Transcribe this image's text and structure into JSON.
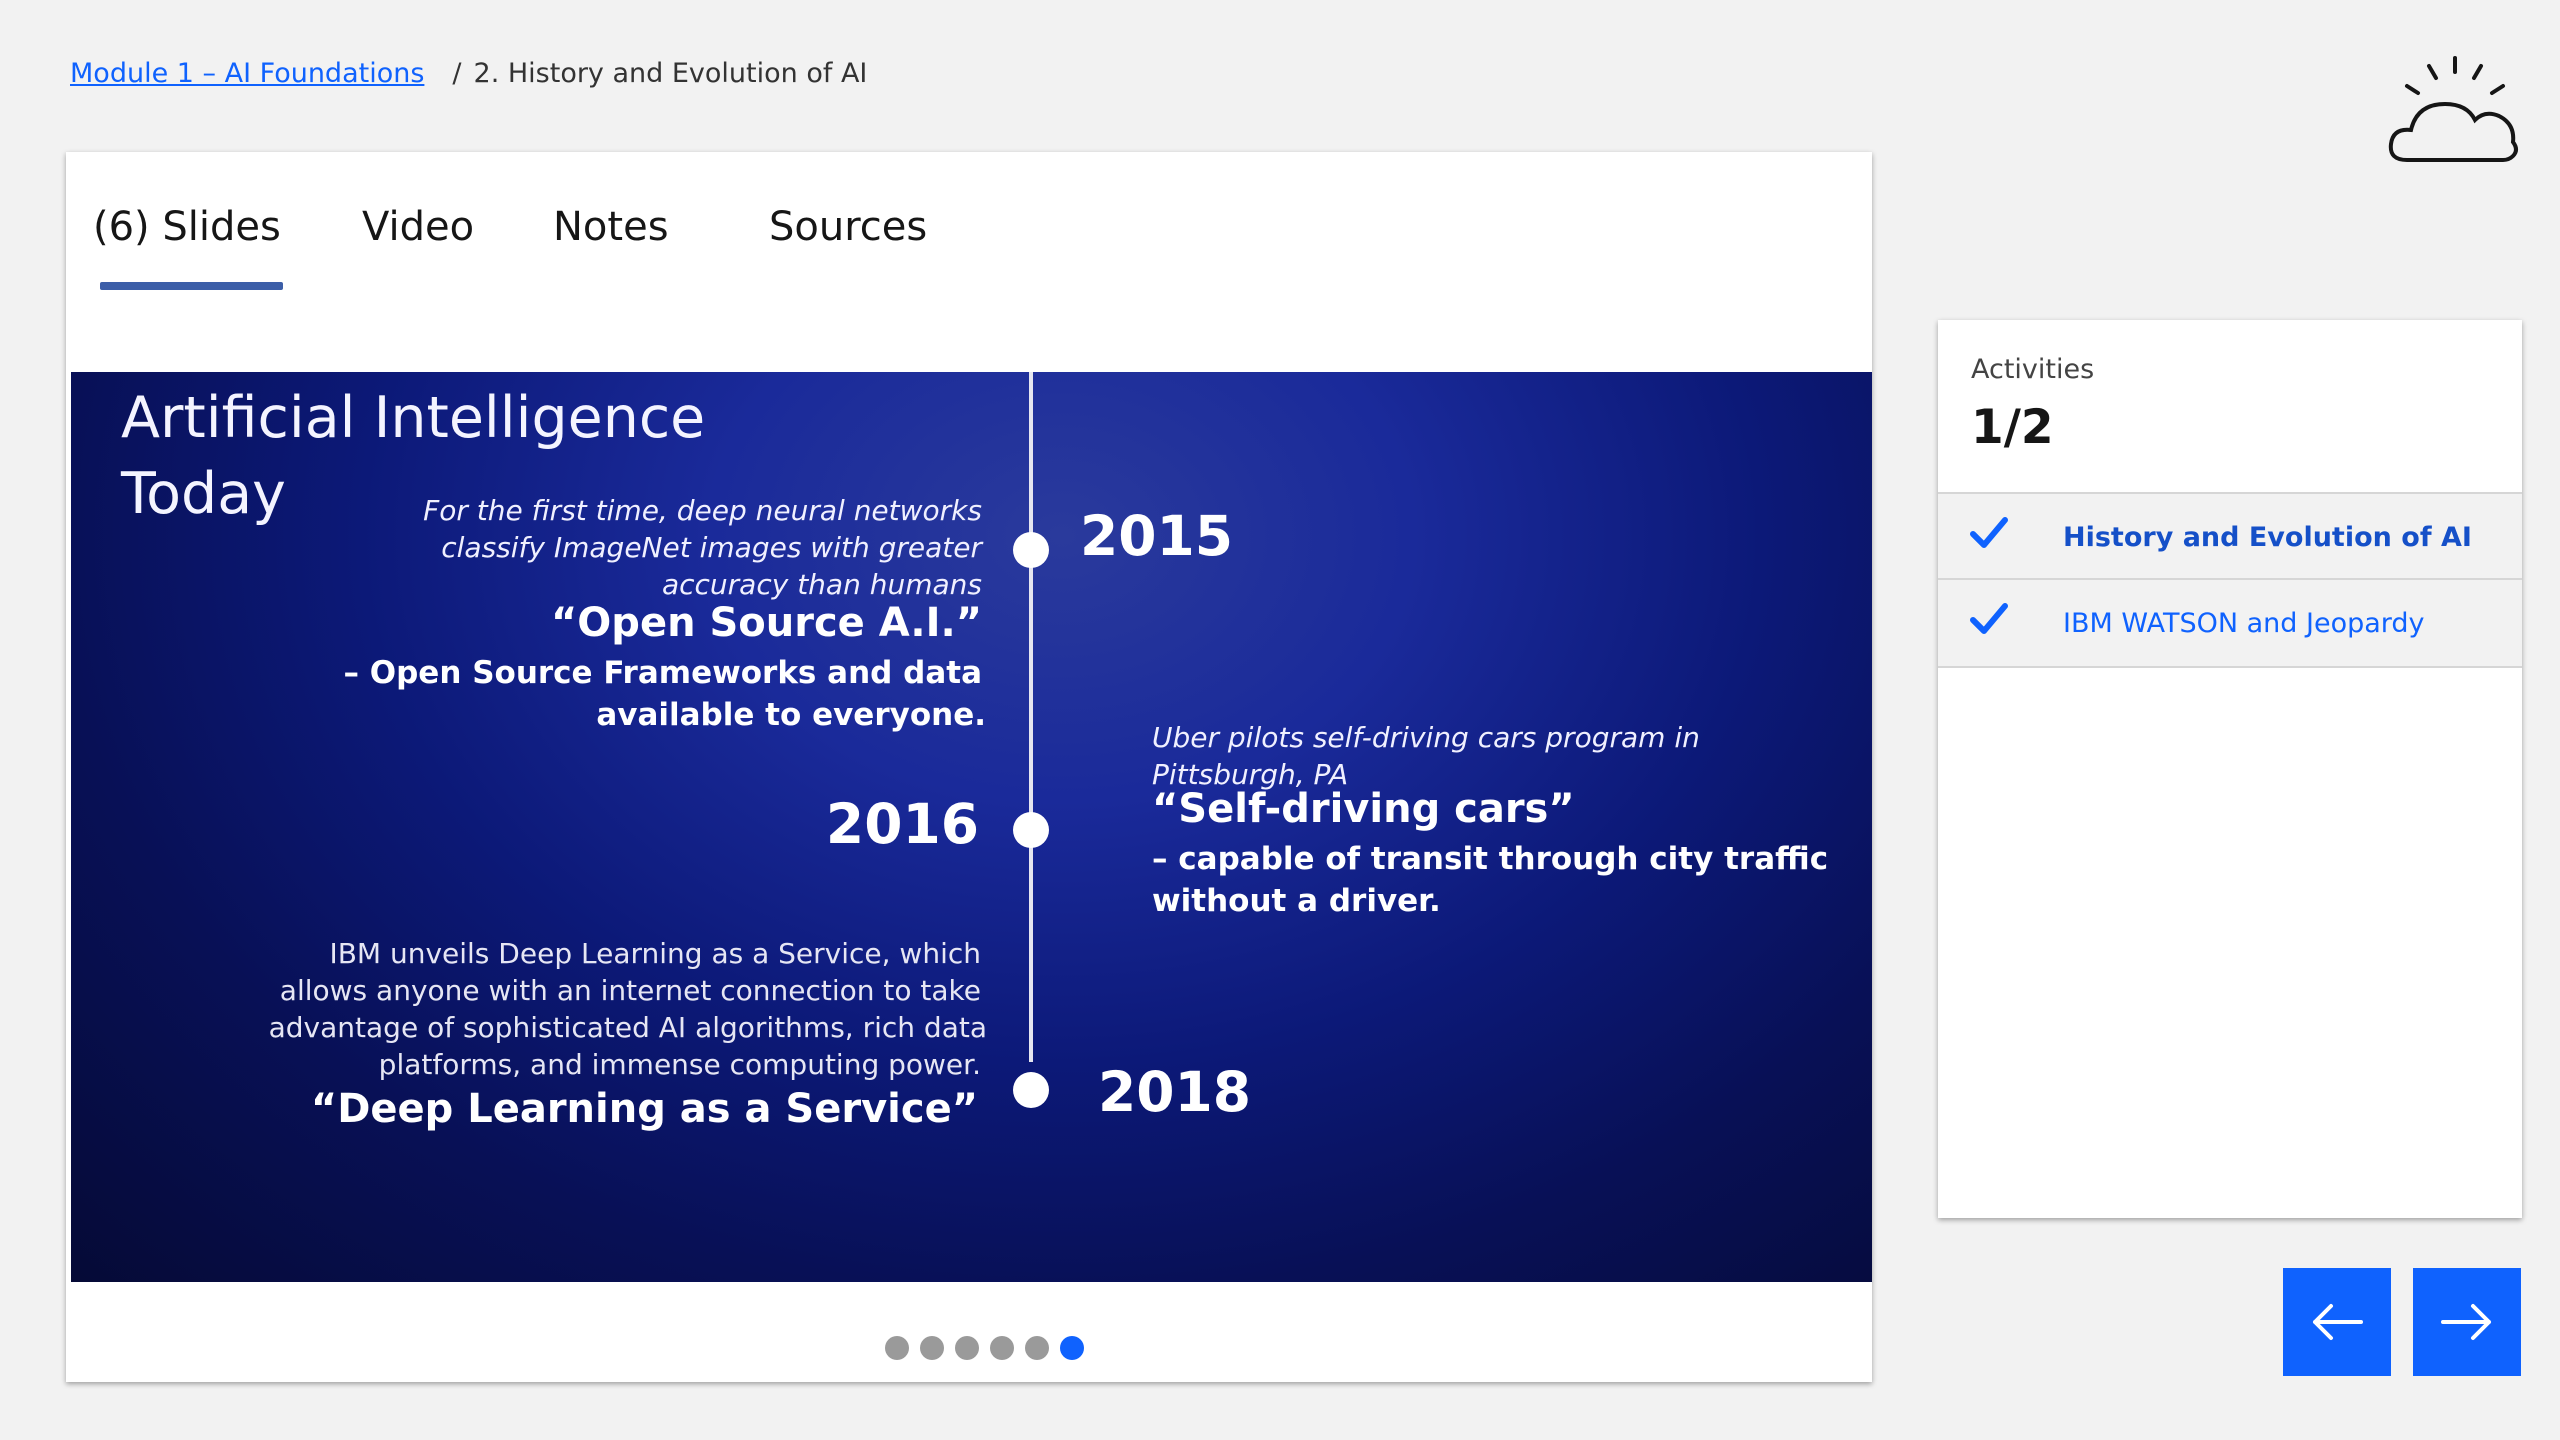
{
  "breadcrumb": {
    "module_link": "Module 1 – AI Foundations",
    "separator": "/",
    "current": "2. History and Evolution of AI"
  },
  "tabs": [
    {
      "label": "(6) Slides",
      "active": true
    },
    {
      "label": "Video"
    },
    {
      "label": "Notes"
    },
    {
      "label": "Sources"
    }
  ],
  "slide": {
    "title": "Artificial Intelligence\nToday",
    "events": {
      "e2015": {
        "year": "2015",
        "desc": "For the first time, deep neural networks classify ImageNet images with greater accuracy than humans",
        "quote": "“Open Source A.I.”",
        "sub1": "– Open Source Frameworks and data",
        "sub2": "available to everyone."
      },
      "e2016": {
        "year": "2016",
        "desc1": "Uber pilots self-driving cars program in",
        "desc2": "Pittsburgh, PA",
        "quote": "“Self-driving cars”",
        "sub1": "– capable of transit through city traffic",
        "sub2": "without a driver."
      },
      "e2018": {
        "year": "2018",
        "desc1": "IBM unveils Deep Learning as a Service, which",
        "desc2": "allows anyone with an internet connection to take",
        "desc3": "advantage of sophisticated AI algorithms, rich data",
        "desc4": "platforms, and immense computing power.",
        "quote": "“Deep Learning as a Service”"
      }
    }
  },
  "pagination": {
    "total": 6,
    "active_index": 6
  },
  "activities": {
    "label": "Activities",
    "count": "1/2",
    "items": [
      {
        "label": "History and Evolution of AI",
        "completed": true,
        "current": true
      },
      {
        "label": "IBM WATSON and Jeopardy",
        "completed": true,
        "current": false
      }
    ]
  },
  "colors": {
    "accent": "#0f62fe",
    "tab_underline": "#3c5ea8",
    "slide_bg": "#0c1978"
  },
  "icons": {
    "logo": "ibm-cloud-icon",
    "check": "checkmark-icon",
    "prev": "arrow-left-icon",
    "next": "arrow-right-icon"
  }
}
